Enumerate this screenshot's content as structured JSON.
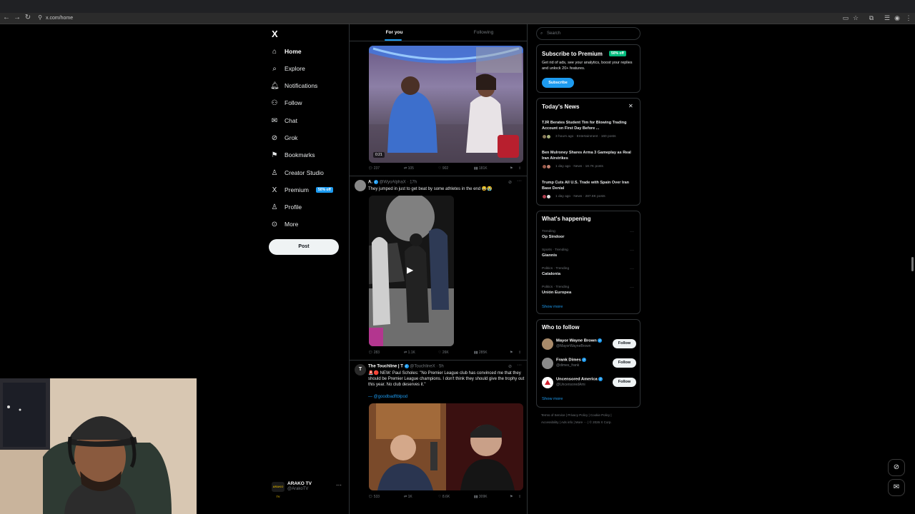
{
  "browser": {
    "url": "x.com/home"
  },
  "nav": {
    "logo": "X",
    "items": [
      {
        "label": "Home",
        "icon": "home-icon",
        "glyph": "⌂"
      },
      {
        "label": "Explore",
        "icon": "search-icon",
        "glyph": "⌕"
      },
      {
        "label": "Notifications",
        "icon": "bell-icon",
        "glyph": "🔔︎"
      },
      {
        "label": "Follow",
        "icon": "add-user-icon",
        "glyph": "⚇"
      },
      {
        "label": "Chat",
        "icon": "mail-icon",
        "glyph": "✉"
      },
      {
        "label": "Grok",
        "icon": "grok-icon",
        "glyph": "⊘"
      },
      {
        "label": "Bookmarks",
        "icon": "bookmark-icon",
        "glyph": "⚑"
      },
      {
        "label": "Creator Studio",
        "icon": "creator-studio-icon",
        "glyph": "♙"
      },
      {
        "label": "Premium",
        "icon": "x-premium-icon",
        "glyph": "X",
        "badge": "50% off"
      },
      {
        "label": "Profile",
        "icon": "profile-icon",
        "glyph": "♙"
      },
      {
        "label": "More",
        "icon": "more-circle-icon",
        "glyph": "⊙"
      }
    ],
    "post_label": "Post",
    "account": {
      "name": "ARAKO TV",
      "handle": "@ArakoTV",
      "avatar_text": "ARAKO TV"
    }
  },
  "feed": {
    "tabs": [
      "For you",
      "Following"
    ],
    "tweets": [
      {
        "media": {
          "duration": "0:21"
        },
        "stats": {
          "replies": "237",
          "reposts": "105",
          "likes": "902",
          "views": "181K"
        }
      },
      {
        "name": "A.",
        "handle": "@WyoAlphaX",
        "time": "17h",
        "text": "They jumped in just to get beat by some athletes in the end 😂😭",
        "stats": {
          "replies": "283",
          "reposts": "1.1K",
          "likes": "26K",
          "views": "285K"
        }
      },
      {
        "name": "The Touchline | T",
        "handle": "@TouchlineX",
        "time": "5h",
        "text": "🚨🔴 NEW: Paul Scholes: \"No Premier League club has convinced me that they should be Premier League champions. I don't think they should give the trophy out this year. No club deserves it.\"",
        "credit": "— @goodbadftblpod",
        "stats": {
          "replies": "533",
          "reposts": "1K",
          "likes": "8.6K",
          "views": "309K"
        }
      }
    ]
  },
  "sidebar": {
    "search_placeholder": "Search",
    "premium": {
      "title": "Subscribe to Premium",
      "badge": "50% off",
      "desc": "Get rid of ads, see your analytics, boost your replies and unlock 20+ features.",
      "button": "Subscribe"
    },
    "news": {
      "title": "Today's News",
      "items": [
        {
          "title": "TJR Berates Student Tim for Blowing Trading Account on First Day Before ...",
          "meta": "3 hours ago · Entertainment · 160 posts"
        },
        {
          "title": "Ben Mulroney Shares Arma 3 Gameplay as Real Iran Airstrikes",
          "meta": "1 day ago · News · 18.7K posts"
        },
        {
          "title": "Trump Cuts All U.S. Trade with Spain Over Iran Base Denial",
          "meta": "1 day ago · News · 287.8K posts"
        }
      ]
    },
    "trending": {
      "title": "What's happening",
      "items": [
        {
          "category": "Trending",
          "name": "Op Sindoor"
        },
        {
          "category": "Sports · Trending",
          "name": "Giannis"
        },
        {
          "category": "Politics · Trending",
          "name": "Catalonia"
        },
        {
          "category": "Politics · Trending",
          "name": "Unión Europea"
        }
      ],
      "show_more": "Show more"
    },
    "who_to_follow": {
      "title": "Who to follow",
      "items": [
        {
          "name": "Mayor Wayne Brown",
          "handle": "@MayorWayneBrown",
          "button": "Follow"
        },
        {
          "name": "Frank Dimes",
          "handle": "@dimes_frank",
          "button": "Follow"
        },
        {
          "name": "Uncensored America",
          "handle": "@UncensoredAmi",
          "button": "Follow"
        }
      ],
      "show_more": "Show more"
    },
    "footer": {
      "links": [
        "Terms of Service",
        "Privacy Policy",
        "Cookie Policy",
        "Accessibility",
        "Ads info",
        "More ···"
      ],
      "copyright": "© 2026 X Corp."
    }
  },
  "colors": {
    "accent": "#1d9bf0",
    "background": "#000000",
    "border": "#2f3336",
    "muted": "#71767b"
  }
}
